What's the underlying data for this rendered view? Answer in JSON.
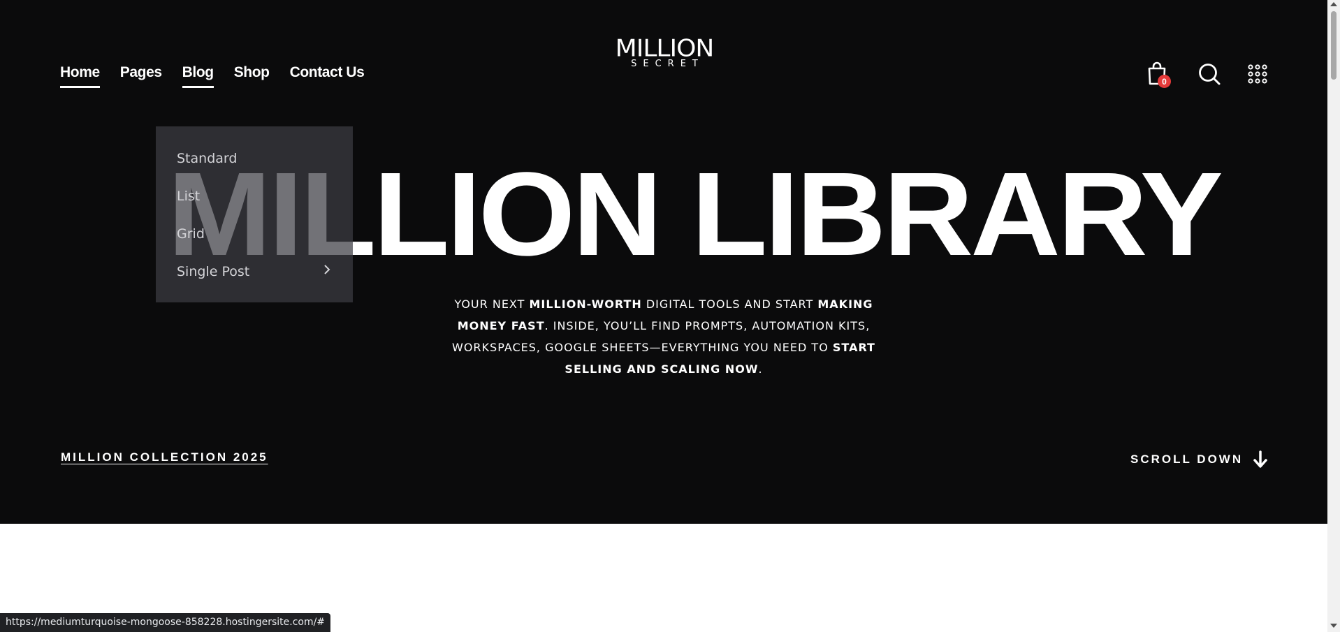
{
  "logo": {
    "line1": "MILLION",
    "line2": "SECRET"
  },
  "nav": {
    "items": [
      {
        "label": "Home"
      },
      {
        "label": "Pages"
      },
      {
        "label": "Blog"
      },
      {
        "label": "Shop"
      },
      {
        "label": "Contact Us"
      }
    ]
  },
  "dropdown": {
    "items": [
      {
        "label": "Standard"
      },
      {
        "label": "List"
      },
      {
        "label": "Grid"
      },
      {
        "label": "Single Post"
      }
    ]
  },
  "header": {
    "cart_count": "0",
    "icons": [
      "shopping-bag-icon",
      "search-icon",
      "grid-menu-icon"
    ]
  },
  "hero": {
    "headline": "MILLION LIBRARY",
    "desc": {
      "p1": "YOUR NEXT ",
      "b1": "MILLION-WORTH",
      "p2": " DIGITAL TOOLS AND START ",
      "b2": "MAKING MONEY FAST",
      "p3": ". INSIDE, YOU’LL FIND PROMPTS, AUTOMATION KITS, WORKSPACES, GOOGLE SHEETS—EVERYTHING YOU NEED TO ",
      "b3": "START SELLING AND SCALING NOW",
      "p4": "."
    },
    "collection_link": "MILLION COLLECTION 2025",
    "scroll_label": "SCROLL DOWN"
  },
  "status_bar": {
    "url": "https://mediumturquoise-mongoose-858228.hostingersite.com/#"
  },
  "colors": {
    "background": "#0b0b0c",
    "badge": "#e53a3a",
    "text": "#ffffff"
  }
}
